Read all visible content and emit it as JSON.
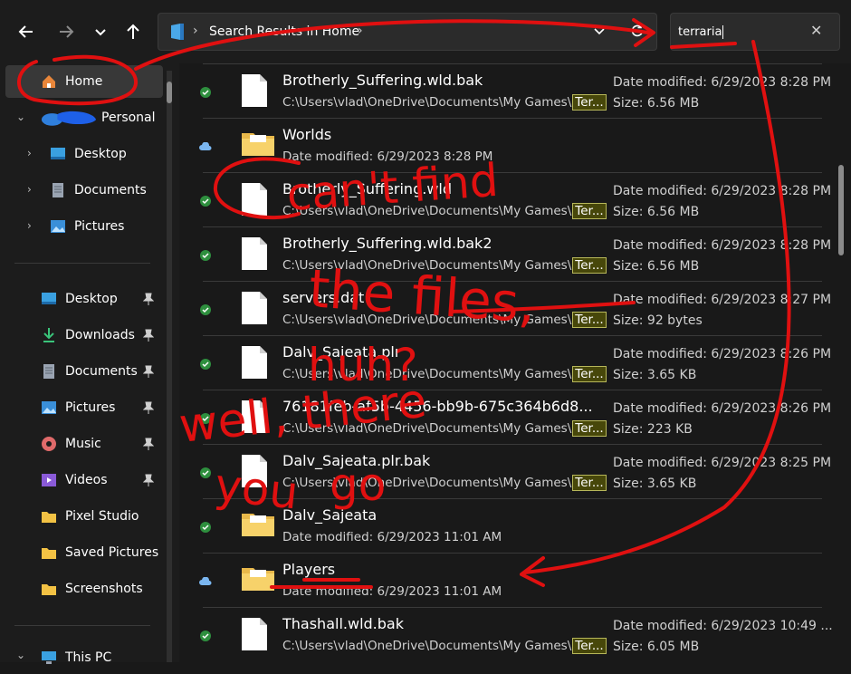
{
  "toolbar": {
    "back_icon": "arrow-left",
    "forward_icon": "arrow-right",
    "recent_icon": "chevron-down",
    "up_icon": "arrow-up",
    "address": {
      "crumb": "Search Results in Home"
    },
    "search": {
      "value": "terraria"
    }
  },
  "sidebar": {
    "home": "Home",
    "personal": "Personal",
    "tree": [
      "Desktop",
      "Documents",
      "Pictures"
    ],
    "quick_access": [
      "Desktop",
      "Downloads",
      "Documents",
      "Pictures",
      "Music",
      "Videos",
      "Pixel Studio",
      "Saved Pictures",
      "Screenshots"
    ],
    "this_pc": "This PC"
  },
  "files": [
    {
      "name": "Brotherly_Suffering.wld.bak",
      "path": "C:\\Users\\vlad\\OneDrive\\Documents\\My Games\\",
      "hl": "Ter...",
      "date": "Date modified: 6/29/2023 8:28 PM",
      "size": "Size: 6.56 MB"
    },
    {
      "name": "Worlds",
      "sub": "Date modified: 6/29/2023 8:28 PM"
    },
    {
      "name": "Brotherly_Suffering.wld",
      "path": "C:\\Users\\vlad\\OneDrive\\Documents\\My Games\\",
      "hl": "Ter...",
      "date": "Date modified: 6/29/2023 8:28 PM",
      "size": "Size: 6.56 MB"
    },
    {
      "name": "Brotherly_Suffering.wld.bak2",
      "path": "C:\\Users\\vlad\\OneDrive\\Documents\\My Games\\",
      "hl": "Ter...",
      "date": "Date modified: 6/29/2023 8:28 PM",
      "size": "Size: 6.56 MB"
    },
    {
      "name": "servers.dat",
      "path": "C:\\Users\\vlad\\OneDrive\\Documents\\My Games\\",
      "hl": "Ter...",
      "date": "Date modified: 6/29/2023 8:27 PM",
      "size": "Size: 92 bytes"
    },
    {
      "name": "Dalv_Sajeata.plr",
      "path": "C:\\Users\\vlad\\OneDrive\\Documents\\My Games\\",
      "hl": "Ter...",
      "date": "Date modified: 6/29/2023 8:26 PM",
      "size": "Size: 3.65 KB"
    },
    {
      "name": "76181feb-af5b-4456-bb9b-675c364b6d8...",
      "path": "C:\\Users\\vlad\\OneDrive\\Documents\\My Games\\",
      "hl": "Ter...",
      "date": "Date modified: 6/29/2023 8:26 PM",
      "size": "Size: 223 KB"
    },
    {
      "name": "Dalv_Sajeata.plr.bak",
      "path": "C:\\Users\\vlad\\OneDrive\\Documents\\My Games\\",
      "hl": "Ter...",
      "date": "Date modified: 6/29/2023 8:25 PM",
      "size": "Size: 3.65 KB"
    },
    {
      "name": "Dalv_Sajeata",
      "sub": "Date modified: 6/29/2023 11:01 AM"
    },
    {
      "name": "Players",
      "sub": "Date modified: 6/29/2023 11:01 AM"
    },
    {
      "name": "Thashall.wld.bak",
      "path": "C:\\Users\\vlad\\OneDrive\\Documents\\My Games\\",
      "hl": "Ter...",
      "date": "Date modified: 6/29/2023 10:49 ...",
      "size": "Size: 6.05 MB"
    }
  ],
  "annotation": {
    "color": "#e01010",
    "lines": [
      "can't find",
      "the files,",
      "huh?",
      "well, there",
      "you",
      "go"
    ]
  }
}
